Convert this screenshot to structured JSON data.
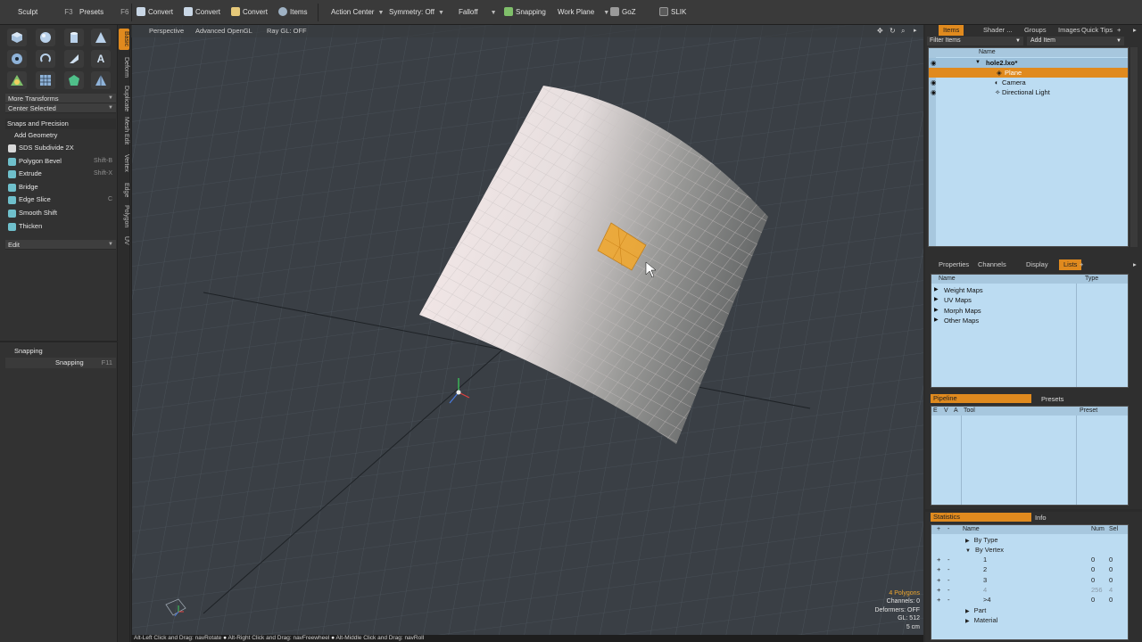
{
  "topbar": {
    "sculpt": "Sculpt",
    "sculpt_key": "F3",
    "presets": "Presets",
    "presets_key": "F6",
    "convert1": "Convert",
    "convert2": "Convert",
    "convert3": "Convert",
    "items": "Items",
    "action_center": "Action Center",
    "symmetry": "Symmetry: Off",
    "falloff": "Falloff",
    "snapping": "Snapping",
    "work_plane": "Work Plane",
    "goz": "GoZ",
    "slik": "SLIK"
  },
  "left": {
    "more_transforms": "More Transforms",
    "center_selected": "Center Selected",
    "snaps_precision": "Snaps and Precision",
    "add_geometry": "Add Geometry",
    "tools": [
      {
        "label": "SDS Subdivide 2X",
        "shortcut": "",
        "color": "#d9d9d9"
      },
      {
        "label": "Polygon Bevel",
        "shortcut": "Shift-B",
        "color": "#6fc0cc"
      },
      {
        "label": "Extrude",
        "shortcut": "Shift-X",
        "color": "#6fc0cc"
      },
      {
        "label": "Bridge",
        "shortcut": "",
        "color": "#6fc0cc"
      },
      {
        "label": "Edge Slice",
        "shortcut": "C",
        "color": "#6fc0cc"
      },
      {
        "label": "Smooth Shift",
        "shortcut": "",
        "color": "#6fc0cc"
      },
      {
        "label": "Thicken",
        "shortcut": "",
        "color": "#6fc0cc"
      }
    ],
    "edit": "Edit",
    "snapping_section": "Snapping",
    "snapping_item": "Snapping",
    "snapping_key": "F11",
    "vtabs": [
      "Basic",
      "Deform",
      "Duplicate",
      "Mesh Edit",
      "Vertex",
      "Edge",
      "Polygon",
      "UV"
    ]
  },
  "viewport": {
    "perspective": "Perspective",
    "advanced_opengl": "Advanced OpenGL",
    "raygl": "Ray GL: OFF",
    "stats": [
      "4 Polygons",
      "Channels: 0",
      "Deformers: OFF",
      "GL: 512",
      "5 cm"
    ]
  },
  "status": {
    "hint1": "Alt-Left Click and Drag: navRotate",
    "hint2": "Alt-Right Click and Drag: navFreewheel",
    "hint3": "Alt-Middle Click and Drag: navRoll"
  },
  "items_panel": {
    "tabs": [
      "Items",
      "Shader ...",
      "Groups",
      "Images",
      "Quick Tips"
    ],
    "filter_items": "Filter Items",
    "add_item": "Add Item",
    "col_name": "Name",
    "scene_name": "hole2.lxo*",
    "plane": "Plane",
    "camera": "Camera",
    "light": "Directional Light"
  },
  "lists_panel": {
    "tabs": [
      "Properties",
      "Channels",
      "Display",
      "Lists"
    ],
    "col_name": "Name",
    "col_type": "Type",
    "items": [
      "Weight Maps",
      "UV Maps",
      "Morph Maps",
      "Other Maps"
    ]
  },
  "pipeline_panel": {
    "tab_pipeline": "Pipeline",
    "tab_presets": "Presets",
    "col_e": "E",
    "col_v": "V",
    "col_a": "A",
    "col_tool": "Tool",
    "col_preset": "Preset"
  },
  "stats_panel": {
    "tab_statistics": "Statistics",
    "tab_info": "Info",
    "col_name": "Name",
    "col_num": "Num",
    "col_sel": "Sel",
    "by_type": "By Type",
    "by_vertex": "By Vertex",
    "rows": [
      {
        "name": "1",
        "num": "0",
        "sel": "0"
      },
      {
        "name": "2",
        "num": "0",
        "sel": "0"
      },
      {
        "name": "3",
        "num": "0",
        "sel": "0"
      },
      {
        "name": "4",
        "num": "256",
        "sel": "4"
      },
      {
        "name": ">4",
        "num": "0",
        "sel": "0"
      }
    ],
    "part": "Part",
    "material": "Material"
  },
  "colors": {
    "accent": "#e08a1e",
    "panel_blue": "#bcdcf2",
    "selection": "#f0a830"
  }
}
